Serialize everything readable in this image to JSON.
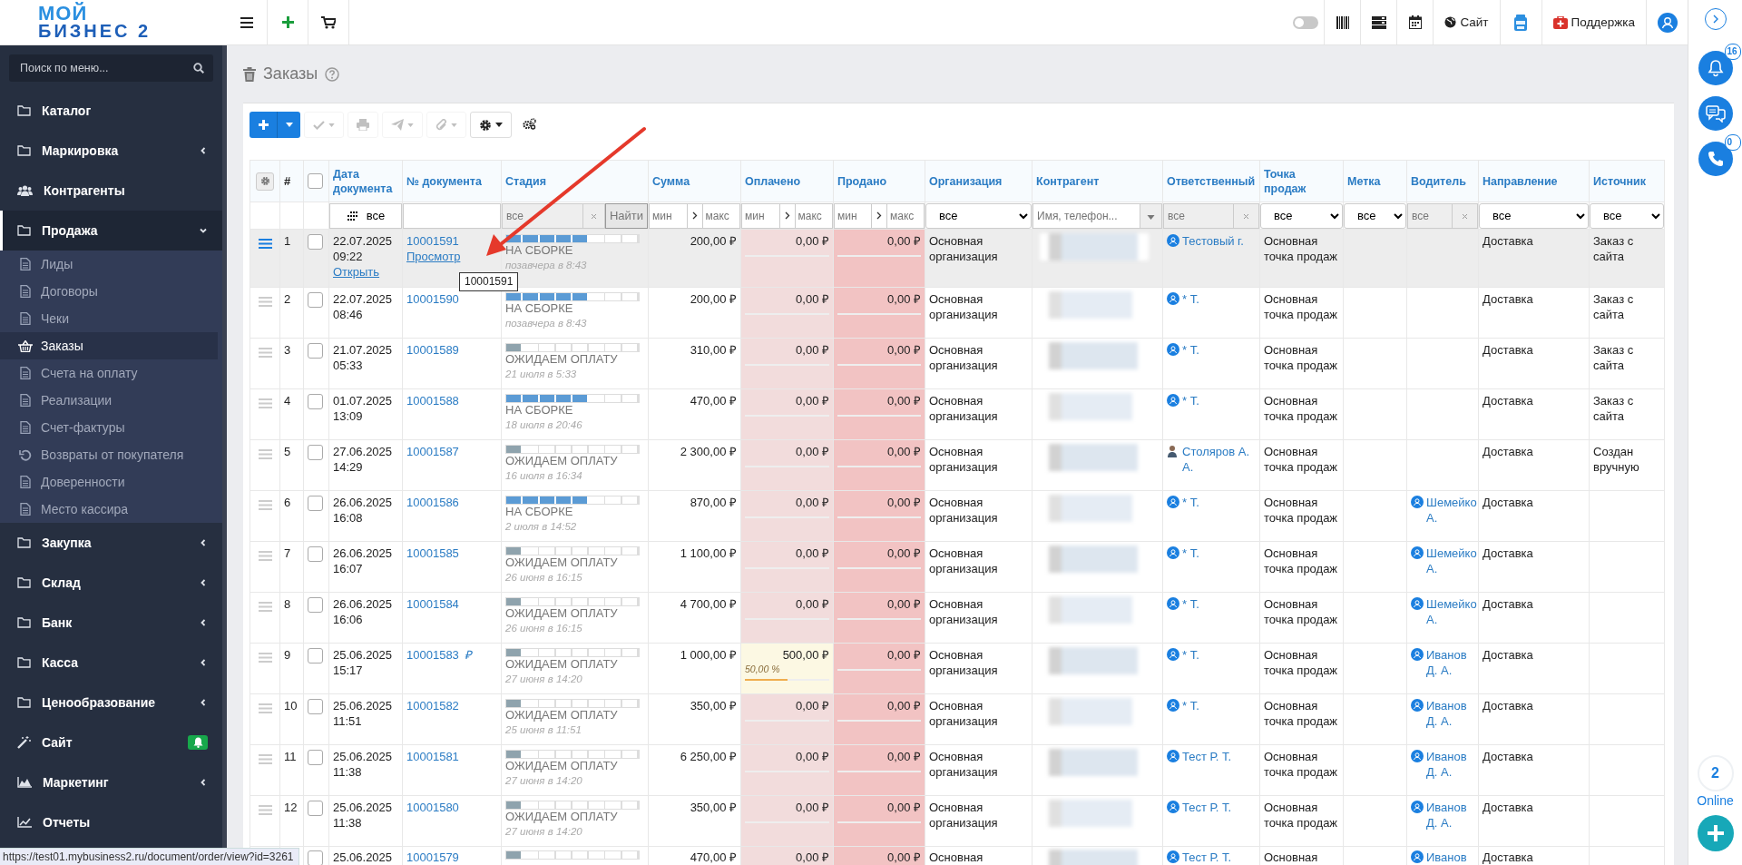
{
  "logo": {
    "line_1": "МОЙ",
    "line_2": "БИЗНЕС 2"
  },
  "topbar": {
    "toggle_on": false,
    "site_label": "Сайт",
    "support_label": "Поддержка"
  },
  "sidebar": {
    "search": {
      "placeholder": "Поиск по меню..."
    },
    "items": [
      {
        "label": "Каталог",
        "expandable": false,
        "expanded": false
      },
      {
        "label": "Маркировка",
        "expandable": true,
        "expanded": false
      },
      {
        "label": "Контрагенты",
        "expandable": false,
        "expanded": false
      },
      {
        "label": "Продажа",
        "expandable": true,
        "expanded": true,
        "children": [
          {
            "label": "Лиды",
            "selected": false
          },
          {
            "label": "Договоры",
            "selected": false
          },
          {
            "label": "Чеки",
            "selected": false
          },
          {
            "label": "Заказы",
            "selected": true
          },
          {
            "label": "Счета на оплату",
            "selected": false
          },
          {
            "label": "Реализации",
            "selected": false
          },
          {
            "label": "Счет-фактуры",
            "selected": false
          },
          {
            "label": "Возвраты от покупателя",
            "selected": false
          },
          {
            "label": "Доверенности",
            "selected": false
          },
          {
            "label": "Место кассира",
            "selected": false
          }
        ]
      },
      {
        "label": "Закупка",
        "expandable": true,
        "expanded": false
      },
      {
        "label": "Склад",
        "expandable": true,
        "expanded": false
      },
      {
        "label": "Банк",
        "expandable": true,
        "expanded": false
      },
      {
        "label": "Касса",
        "expandable": true,
        "expanded": false
      },
      {
        "label": "Ценообразование",
        "expandable": true,
        "expanded": false
      },
      {
        "label": "Сайт",
        "expandable": false,
        "expanded": false,
        "notification": true
      },
      {
        "label": "Маркетинг",
        "expandable": true,
        "expanded": false
      },
      {
        "label": "Отчеты",
        "expandable": false,
        "expanded": false
      }
    ]
  },
  "page": {
    "title": "Заказы"
  },
  "toolbar": [
    {
      "disabled": false
    },
    {
      "disabled": true
    },
    {
      "disabled": true
    },
    {
      "disabled": true
    },
    {
      "disabled": true
    },
    {
      "disabled": false
    },
    {
      "disabled": false
    }
  ],
  "table": {
    "columns": [
      {
        "kind": "settings"
      },
      {
        "kind": "index",
        "label": "#"
      },
      {
        "kind": "check",
        "checked": false
      },
      {
        "kind": "date",
        "label": "Дата документа",
        "filter": {
          "kind": "date",
          "value": "все"
        }
      },
      {
        "kind": "doc",
        "label": "№ документа",
        "filter": {
          "kind": "text"
        }
      },
      {
        "kind": "stage",
        "label": "Стадия",
        "filter": {
          "kind": "search",
          "placeholder": "все",
          "button": "Найти"
        }
      },
      {
        "kind": "money",
        "label": "Сумма",
        "filter": {
          "kind": "range",
          "min": {
            "placeholder": "мин"
          },
          "max": {
            "placeholder": "макс"
          }
        }
      },
      {
        "kind": "money",
        "label": "Оплачено",
        "filter": {
          "kind": "range",
          "min": {
            "placeholder": "мин"
          },
          "max": {
            "placeholder": "макс"
          }
        }
      },
      {
        "kind": "money",
        "label": "Продано",
        "filter": {
          "kind": "range",
          "min": {
            "placeholder": "мин"
          },
          "max": {
            "placeholder": "макс"
          }
        }
      },
      {
        "kind": "text",
        "label": "Организация",
        "filter": {
          "kind": "select",
          "value": "все"
        }
      },
      {
        "kind": "text",
        "label": "Контрагент",
        "filter": {
          "kind": "combo",
          "placeholder": "Имя, телефон..."
        }
      },
      {
        "kind": "text",
        "label": "Ответственный",
        "filter": {
          "kind": "clear",
          "placeholder": "все"
        }
      },
      {
        "kind": "text",
        "label": "Точка продаж",
        "filter": {
          "kind": "select",
          "value": "все"
        }
      },
      {
        "kind": "text",
        "label": "Метка",
        "filter": {
          "kind": "select",
          "value": "все"
        }
      },
      {
        "kind": "text",
        "label": "Водитель",
        "filter": {
          "kind": "clear",
          "placeholder": "все"
        }
      },
      {
        "kind": "text",
        "label": "Направление",
        "filter": {
          "kind": "select",
          "value": "все"
        }
      },
      {
        "kind": "text",
        "label": "Источник",
        "filter": {
          "kind": "select",
          "value": "все"
        }
      }
    ],
    "rows": [
      {
        "selected": true,
        "num": "1",
        "checked": false,
        "date": "22.07.2025",
        "time": "09:22",
        "open_link": "Открыть",
        "doc": "10001591",
        "view_link": "Просмотр",
        "tooltip": "10001591",
        "stage": {
          "label": "НА СБОРКЕ",
          "level": 0.625,
          "color": "#5b9bd5",
          "updated": "позавчера в 8:43"
        },
        "sum": "200,00 ₽",
        "paid": {
          "amount": "0,00 ₽"
        },
        "sold": {
          "amount": "0,00 ₽"
        },
        "org": "Основная организация",
        "responsible": {
          "name": "Тестовый г.",
          "photo": false
        },
        "point": "Основная точка продаж",
        "direction": "Доставка",
        "source": "Заказ с сайта"
      },
      {
        "selected": false,
        "num": "2",
        "checked": false,
        "date": "22.07.2025",
        "time": "08:46",
        "doc": "10001590",
        "stage": {
          "label": "НА СБОРКЕ",
          "level": 0.625,
          "color": "#5b9bd5",
          "updated": "позавчера в 8:43"
        },
        "sum": "200,00 ₽",
        "paid": {
          "amount": "0,00 ₽"
        },
        "sold": {
          "amount": "0,00 ₽"
        },
        "org": "Основная организация",
        "responsible": {
          "name": "* Т.",
          "photo": false
        },
        "point": "Основная точка продаж",
        "direction": "Доставка",
        "source": "Заказ с сайта"
      },
      {
        "selected": false,
        "num": "3",
        "checked": false,
        "date": "21.07.2025",
        "time": "05:33",
        "doc": "10001589",
        "stage": {
          "label": "ОЖИДАЕМ ОПЛАТУ",
          "level": 0.125,
          "color": "#8fa3ad",
          "updated": "21 июля в 5:33"
        },
        "sum": "310,00 ₽",
        "paid": {
          "amount": "0,00 ₽"
        },
        "sold": {
          "amount": "0,00 ₽"
        },
        "org": "Основная организация",
        "responsible": {
          "name": "* Т.",
          "photo": false
        },
        "point": "Основная точка продаж",
        "direction": "Доставка",
        "source": "Заказ с сайта"
      },
      {
        "selected": false,
        "num": "4",
        "checked": false,
        "date": "01.07.2025",
        "time": "13:09",
        "doc": "10001588",
        "stage": {
          "label": "НА СБОРКЕ",
          "level": 0.625,
          "color": "#5b9bd5",
          "updated": "18 июля в 20:46"
        },
        "sum": "470,00 ₽",
        "paid": {
          "amount": "0,00 ₽"
        },
        "sold": {
          "amount": "0,00 ₽"
        },
        "org": "Основная организация",
        "responsible": {
          "name": "* Т.",
          "photo": false
        },
        "point": "Основная точка продаж",
        "direction": "Доставка",
        "source": "Заказ с сайта"
      },
      {
        "selected": false,
        "num": "5",
        "checked": false,
        "date": "27.06.2025",
        "time": "14:29",
        "doc": "10001587",
        "stage": {
          "label": "ОЖИДАЕМ ОПЛАТУ",
          "level": 0.125,
          "color": "#8fa3ad",
          "updated": "16 июля в 16:34"
        },
        "sum": "2 300,00 ₽",
        "paid": {
          "amount": "0,00 ₽"
        },
        "sold": {
          "amount": "0,00 ₽"
        },
        "org": "Основная организация",
        "responsible": {
          "name": "Столяров А. А.",
          "photo": true
        },
        "point": "Основная точка продаж",
        "direction": "Доставка",
        "source": "Создан вручную"
      },
      {
        "selected": false,
        "num": "6",
        "checked": false,
        "date": "26.06.2025",
        "time": "16:08",
        "doc": "10001586",
        "stage": {
          "label": "НА СБОРКЕ",
          "level": 0.625,
          "color": "#5b9bd5",
          "updated": "2 июля в 14:52"
        },
        "sum": "870,00 ₽",
        "paid": {
          "amount": "0,00 ₽"
        },
        "sold": {
          "amount": "0,00 ₽"
        },
        "org": "Основная организация",
        "responsible": {
          "name": "* Т.",
          "photo": false
        },
        "point": "Основная точка продаж",
        "driver": "Шемейко А.",
        "direction": "Доставка"
      },
      {
        "selected": false,
        "num": "7",
        "checked": false,
        "date": "26.06.2025",
        "time": "16:07",
        "doc": "10001585",
        "stage": {
          "label": "ОЖИДАЕМ ОПЛАТУ",
          "level": 0.125,
          "color": "#8fa3ad",
          "updated": "26 июня в 16:15"
        },
        "sum": "1 100,00 ₽",
        "paid": {
          "amount": "0,00 ₽"
        },
        "sold": {
          "amount": "0,00 ₽"
        },
        "org": "Основная организация",
        "responsible": {
          "name": "* Т.",
          "photo": false
        },
        "point": "Основная точка продаж",
        "driver": "Шемейко А.",
        "direction": "Доставка"
      },
      {
        "selected": false,
        "num": "8",
        "checked": false,
        "date": "26.06.2025",
        "time": "16:06",
        "doc": "10001584",
        "stage": {
          "label": "ОЖИДАЕМ ОПЛАТУ",
          "level": 0.125,
          "color": "#8fa3ad",
          "updated": "26 июня в 16:15"
        },
        "sum": "4 700,00 ₽",
        "paid": {
          "amount": "0,00 ₽"
        },
        "sold": {
          "amount": "0,00 ₽"
        },
        "org": "Основная организация",
        "responsible": {
          "name": "* Т.",
          "photo": false
        },
        "point": "Основная точка продаж",
        "driver": "Шемейко А.",
        "direction": "Доставка"
      },
      {
        "selected": false,
        "num": "9",
        "checked": false,
        "date": "25.06.2025",
        "time": "15:17",
        "doc": "10001583",
        "doc_mark": "₽",
        "stage": {
          "label": "ОЖИДАЕМ ОПЛАТУ",
          "level": 0.125,
          "color": "#8fa3ad",
          "updated": "27 июня в 14:20"
        },
        "sum": "1 000,00 ₽",
        "paid": {
          "amount": "500,00 ₽",
          "percent": "50,00 %",
          "level": 0.5
        },
        "sold": {
          "amount": "0,00 ₽"
        },
        "org": "Основная организация",
        "responsible": {
          "name": "* Т.",
          "photo": false
        },
        "point": "Основная точка продаж",
        "driver": "Иванов Д. А.",
        "direction": "Доставка"
      },
      {
        "selected": false,
        "num": "10",
        "checked": false,
        "date": "25.06.2025",
        "time": "11:51",
        "doc": "10001582",
        "stage": {
          "label": "ОЖИДАЕМ ОПЛАТУ",
          "level": 0.125,
          "color": "#8fa3ad",
          "updated": "25 июня в 11:51"
        },
        "sum": "350,00 ₽",
        "paid": {
          "amount": "0,00 ₽"
        },
        "sold": {
          "amount": "0,00 ₽"
        },
        "org": "Основная организация",
        "responsible": {
          "name": "* Т.",
          "photo": false
        },
        "point": "Основная точка продаж",
        "driver": "Иванов Д. А.",
        "direction": "Доставка"
      },
      {
        "selected": false,
        "num": "11",
        "checked": false,
        "date": "25.06.2025",
        "time": "11:38",
        "doc": "10001581",
        "stage": {
          "label": "ОЖИДАЕМ ОПЛАТУ",
          "level": 0.125,
          "color": "#8fa3ad",
          "updated": "27 июня в 14:20"
        },
        "sum": "6 250,00 ₽",
        "paid": {
          "amount": "0,00 ₽"
        },
        "sold": {
          "amount": "0,00 ₽"
        },
        "org": "Основная организация",
        "responsible": {
          "name": "Тест Р. Т.",
          "photo": false
        },
        "point": "Основная точка продаж",
        "driver": "Иванов Д. А.",
        "direction": "Доставка"
      },
      {
        "selected": false,
        "num": "12",
        "checked": false,
        "date": "25.06.2025",
        "time": "11:38",
        "doc": "10001580",
        "stage": {
          "label": "ОЖИДАЕМ ОПЛАТУ",
          "level": 0.125,
          "color": "#8fa3ad",
          "updated": "27 июня в 14:20"
        },
        "sum": "350,00 ₽",
        "paid": {
          "amount": "0,00 ₽"
        },
        "sold": {
          "amount": "0,00 ₽"
        },
        "org": "Основная организация",
        "responsible": {
          "name": "Тест Р. Т.",
          "photo": false
        },
        "point": "Основная точка продаж",
        "driver": "Иванов Д. А.",
        "direction": "Доставка"
      },
      {
        "selected": false,
        "checked": false,
        "date": "25.06.2025",
        "doc": "10001579",
        "stage": {
          "level": 0.125,
          "color": "#8fa3ad"
        },
        "sum": "470,00 ₽",
        "paid": {
          "amount": "0,00 ₽"
        },
        "sold": {
          "amount": "0,00 ₽"
        },
        "org": "Основная",
        "responsible": {
          "name": "Тест Р. Т.",
          "photo": false
        },
        "point": "Основная",
        "driver": "Иванов",
        "direction": "Доставка"
      }
    ]
  },
  "status_url": "https://test01.mybusiness2.ru/document/order/view?id=3261",
  "right_panel": {
    "notifications": "16",
    "calls": "0",
    "online_count": "2",
    "online_label": "Online"
  }
}
